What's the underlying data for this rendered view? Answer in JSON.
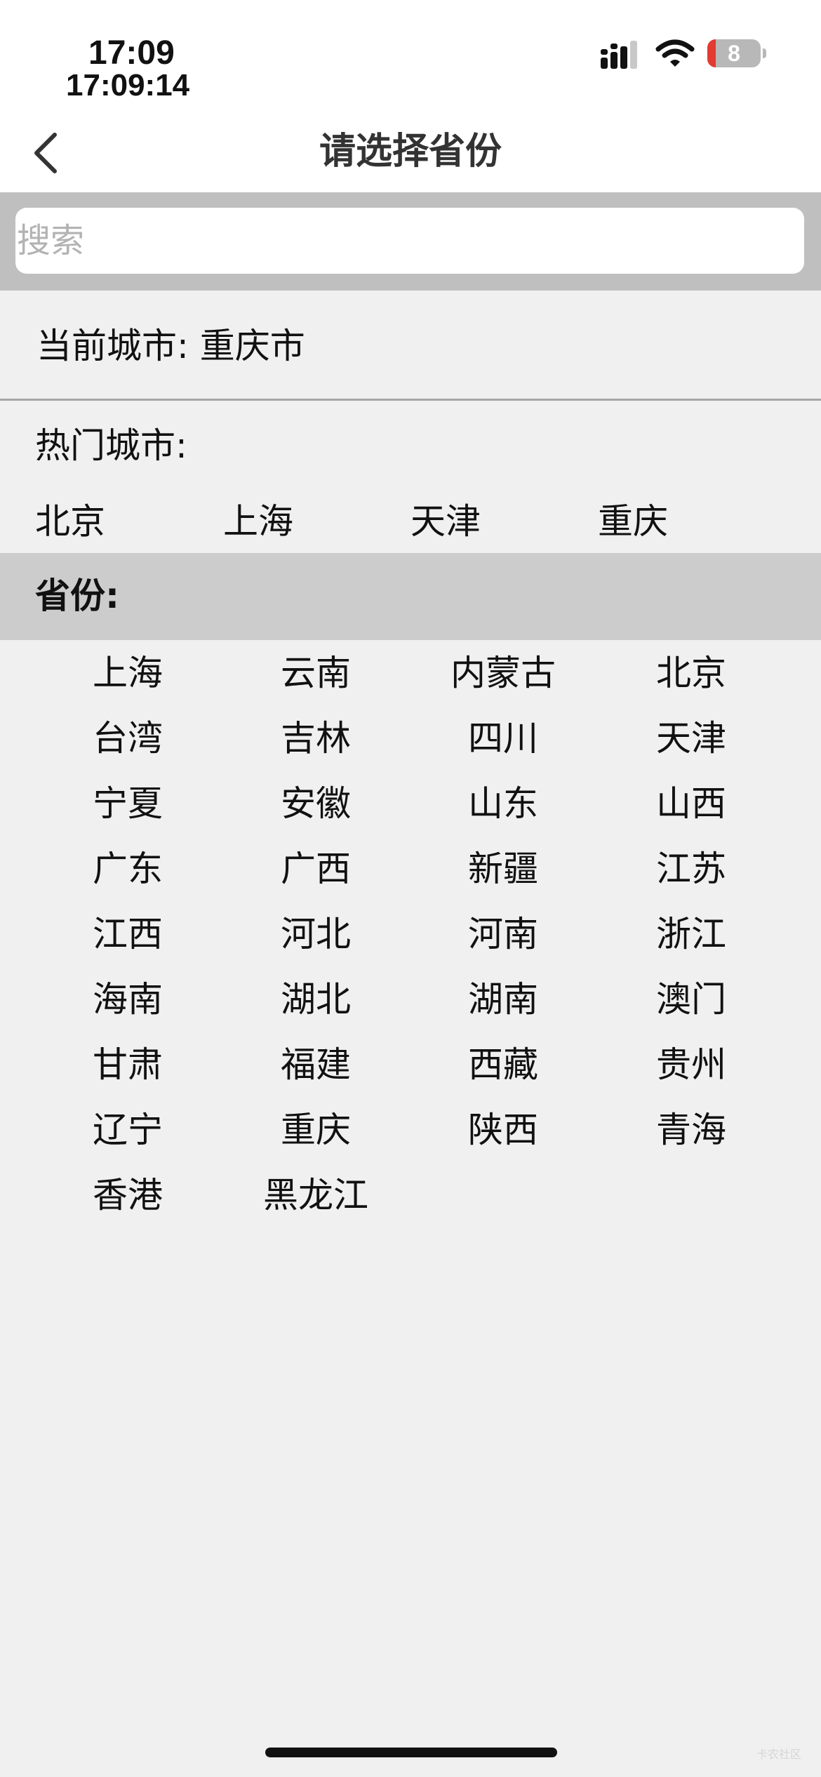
{
  "status_bar": {
    "time": "17:09",
    "time_seconds": "17:09:14",
    "battery_level": "8",
    "battery_color": "#e23b32",
    "signal_icon": "cellular-signal-icon",
    "wifi_icon": "wifi-icon"
  },
  "nav": {
    "back_icon": "chevron-left-icon",
    "title": "请选择省份"
  },
  "search": {
    "placeholder": "搜索",
    "value": ""
  },
  "current_city": {
    "text": "当前城市: 重庆市"
  },
  "hot_cities": {
    "label": "热门城市:",
    "items": [
      "北京",
      "上海",
      "天津",
      "重庆"
    ]
  },
  "provinces": {
    "label": "省份:",
    "items": [
      "上海",
      "云南",
      "内蒙古",
      "北京",
      "台湾",
      "吉林",
      "四川",
      "天津",
      "宁夏",
      "安徽",
      "山东",
      "山西",
      "广东",
      "广西",
      "新疆",
      "江苏",
      "江西",
      "河北",
      "河南",
      "浙江",
      "海南",
      "湖北",
      "湖南",
      "澳门",
      "甘肃",
      "福建",
      "西藏",
      "贵州",
      "辽宁",
      "重庆",
      "陕西",
      "青海",
      "香港",
      "黑龙江"
    ]
  },
  "watermark": "卡农社区"
}
